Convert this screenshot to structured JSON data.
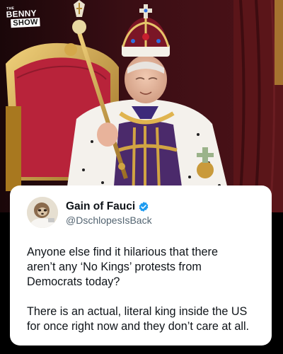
{
  "logo": {
    "line1": "THE",
    "line2": "BENNY",
    "line3": "SHOW"
  },
  "tweet": {
    "display_name": "Gain of Fauci",
    "handle": "@DschlopesIsBack",
    "verified": true,
    "paragraphs": [
      "Anyone else find it hilarious that there\naren’t any ‘No Kings’ protests from\nDemocrats today?",
      "There is an actual, literal king inside the US\nfor once right now and they don’t care at all."
    ]
  },
  "colors": {
    "verified_badge": "#1d9bf0",
    "name_text": "#0f1419",
    "handle_text": "#536471",
    "throne_red": "#b8233a",
    "gold": "#c99a3b",
    "ermine": "#f4f1ec"
  },
  "icons": [
    "verified-badge-icon",
    "scepter-icon",
    "crown-icon"
  ]
}
